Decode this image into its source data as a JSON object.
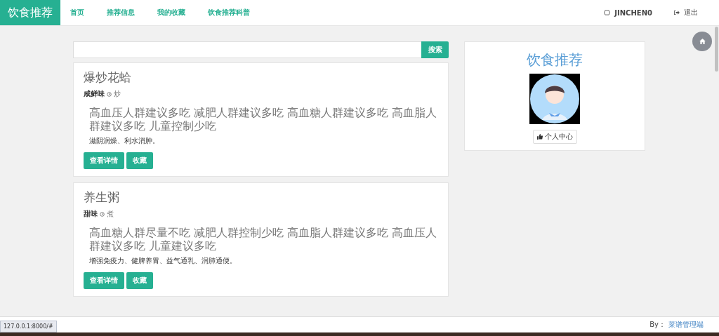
{
  "navbar": {
    "brand": "饮食推荐",
    "items": [
      {
        "label": "首页"
      },
      {
        "label": "推荐信息"
      },
      {
        "label": "我的收藏"
      },
      {
        "label": "饮食推荐科普"
      }
    ],
    "user": "JINCHEN0",
    "logout": "退出"
  },
  "search": {
    "button": "搜索"
  },
  "recipes": [
    {
      "title": "爆炒花蛤",
      "flavor": "咸鲜味",
      "method": "炒",
      "advice": "高血压人群建议多吃 减肥人群建议多吃 高血糖人群建议多吃 高血脂人群建议多吃 儿童控制少吃",
      "effect": "滋阴润燥、利水消肿。",
      "buttons": [
        "查看详情",
        "收藏"
      ]
    },
    {
      "title": "养生粥",
      "flavor": "甜味",
      "method": "煮",
      "advice": "高血糖人群尽量不吃 减肥人群控制少吃 高血脂人群建议多吃 高血压人群建议多吃 儿童建议多吃",
      "effect": "增强免疫力、健脾养胃、益气通乳、润肺通便。",
      "buttons": [
        "查看详情",
        "收藏"
      ]
    }
  ],
  "sidebar": {
    "title": "饮食推荐",
    "button": "个人中心"
  },
  "footer": {
    "by": "By：",
    "link": "菜谱管理端"
  },
  "status_url": "127.0.0.1:8000/#"
}
